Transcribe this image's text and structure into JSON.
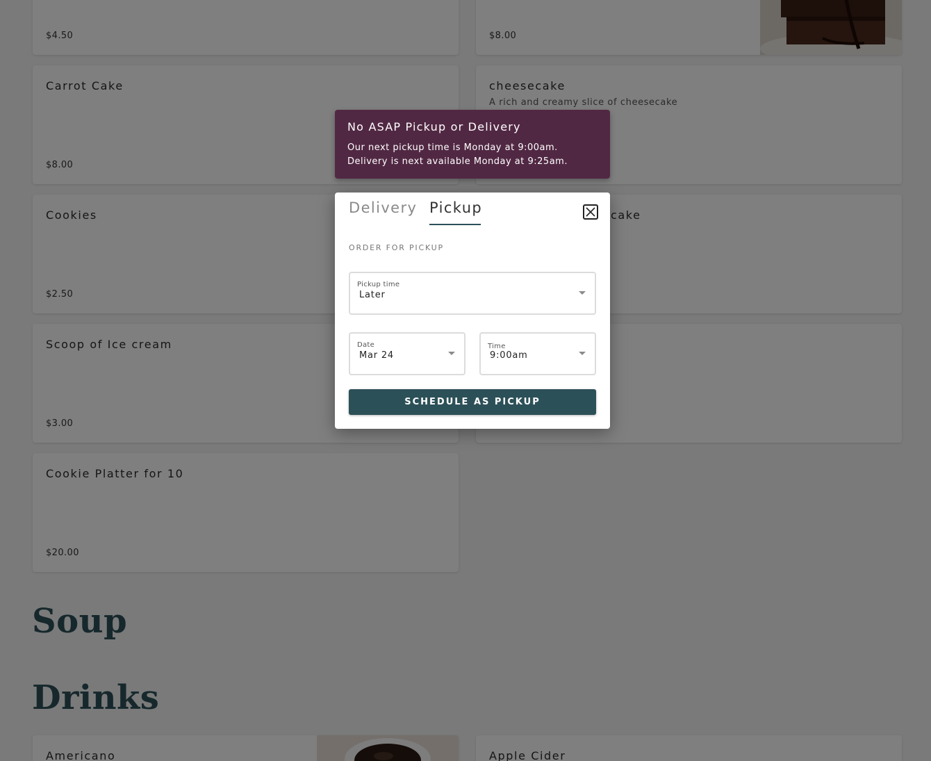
{
  "menu": {
    "dessert_items": [
      {
        "name": "",
        "description": "",
        "price": "$4.50"
      },
      {
        "name": "",
        "description": "",
        "price": "$8.00"
      },
      {
        "name": "Carrot Cake",
        "description": "",
        "price": "$8.00"
      },
      {
        "name": "cheesecake",
        "description": "A rich and creamy slice of cheesecake",
        "price": ""
      },
      {
        "name": "Cookies",
        "description": "",
        "price": "$2.50"
      },
      {
        "name": "cake",
        "description": "",
        "price": ""
      },
      {
        "name": "Scoop of Ice cream",
        "description": "",
        "price": "$3.00"
      },
      {
        "name": "",
        "description": "",
        "price": ""
      },
      {
        "name": "Cookie Platter for 10",
        "description": "",
        "price": "$20.00"
      }
    ],
    "sections": {
      "soup": "Soup",
      "drinks": "Drinks"
    },
    "drink_items": [
      {
        "name": "Americano"
      },
      {
        "name": "Apple Cider"
      }
    ],
    "images": {
      "brownie": "brownie-photo",
      "coffee": "coffee-cup-photo"
    }
  },
  "banner": {
    "title": "No ASAP Pickup or Delivery",
    "line1": "Our next pickup time is Monday at 9:00am.",
    "line2": "Delivery is next available Monday at 9:25am."
  },
  "modal": {
    "tabs": {
      "delivery": "Delivery",
      "pickup": "Pickup",
      "active": "Pickup"
    },
    "order_label": "ORDER FOR PICKUP",
    "pickup_time": {
      "label": "Pickup time",
      "value": "Later"
    },
    "date": {
      "label": "Date",
      "value": "Mar 24"
    },
    "time": {
      "label": "Time",
      "value": "9:00am"
    },
    "schedule_button": "SCHEDULE AS PICKUP",
    "close_icon": "close-icon"
  },
  "colors": {
    "brand": "#2c5058",
    "banner": "#512843",
    "page_bg": "#f4f4f4"
  }
}
